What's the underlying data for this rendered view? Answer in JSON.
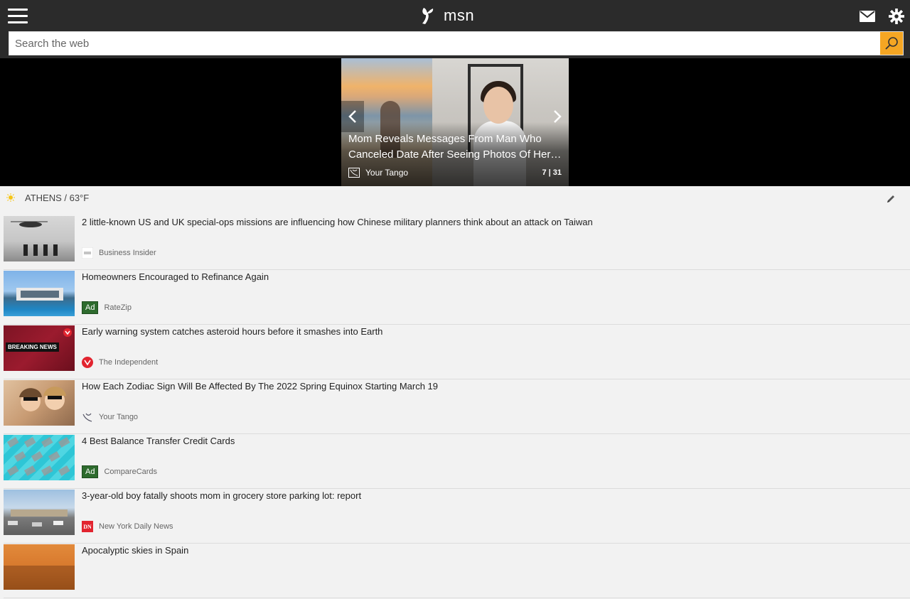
{
  "header": {
    "brand": "msn",
    "search": {
      "placeholder": "Search the web",
      "value": ""
    },
    "icons": [
      "hamburger-menu-icon",
      "msn-logo-icon",
      "mail-icon",
      "gear-icon",
      "search-icon"
    ]
  },
  "hero": {
    "title": "Mom Reveals Messages From Man Who Canceled Date After Seeing Photos Of Her…",
    "source": "Your Tango",
    "counter": "7 | 31"
  },
  "weather": {
    "location_temp": "ATHENS / 63°F",
    "icon": "sun-icon"
  },
  "feed": [
    {
      "headline": "2 little-known US and UK special-ops missions are influencing how Chinese military planners think about an attack on Taiwan",
      "source": "Business Insider",
      "ad": ""
    },
    {
      "headline": "Homeowners Encouraged to Refinance Again",
      "source": "RateZip",
      "ad": "Ad"
    },
    {
      "headline": "Early warning system catches asteroid hours before it smashes into Earth",
      "source": "The Independent",
      "ad": "",
      "thumb_text": "BREAKING NEWS"
    },
    {
      "headline": "How Each Zodiac Sign Will Be Affected By The 2022 Spring Equinox Starting March 19",
      "source": "Your Tango",
      "ad": ""
    },
    {
      "headline": "4 Best Balance Transfer Credit Cards",
      "source": "CompareCards",
      "ad": "Ad"
    },
    {
      "headline": "3-year-old boy fatally shoots mom in grocery store parking lot: report",
      "source": "New York Daily News",
      "ad": "",
      "source_logo_text": "DN"
    },
    {
      "headline": "Apocalyptic skies in Spain",
      "source": "",
      "ad": ""
    }
  ],
  "colors": {
    "topbar": "#2b2b2b",
    "search_button": "#f5a623",
    "ad_badge": "#2e6b2e",
    "background": "#f2f2f2"
  }
}
